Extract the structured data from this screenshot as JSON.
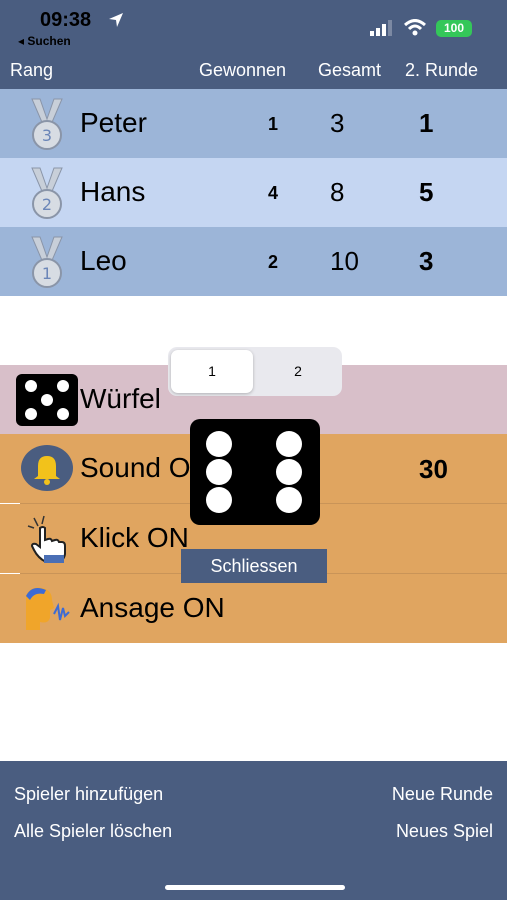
{
  "status_bar": {
    "time": "09:38",
    "back_label": "◂ Suchen",
    "battery": "100"
  },
  "table_header": {
    "rank": "Rang",
    "won": "Gewonnen",
    "total": "Gesamt",
    "round": "2. Runde"
  },
  "players": [
    {
      "name": "Peter",
      "medal": "3",
      "won": "1",
      "total": "3",
      "round": "1",
      "bg": "#9cb5d8"
    },
    {
      "name": "Hans",
      "medal": "2",
      "won": "4",
      "total": "8",
      "round": "5",
      "bg": "#c5d6f2"
    },
    {
      "name": "Leo",
      "medal": "1",
      "won": "2",
      "total": "10",
      "round": "3",
      "bg": "#9cb5d8"
    }
  ],
  "settings": {
    "dice_label": "Würfel",
    "sound_label": "Sound ON",
    "sound_value": "30",
    "click_label": "Klick ON",
    "announce_label": "Ansage ON",
    "dice_row_color": "#d8bfc9",
    "orange_color": "#e0a560"
  },
  "overlay": {
    "segments": [
      "1",
      "2"
    ],
    "selected_segment": "1",
    "die_value": 6,
    "close_label": "Schliessen"
  },
  "footer": {
    "add_player": "Spieler hinzufügen",
    "delete_players": "Alle Spieler löschen",
    "new_round": "Neue Runde",
    "new_game": "Neues Spiel"
  }
}
